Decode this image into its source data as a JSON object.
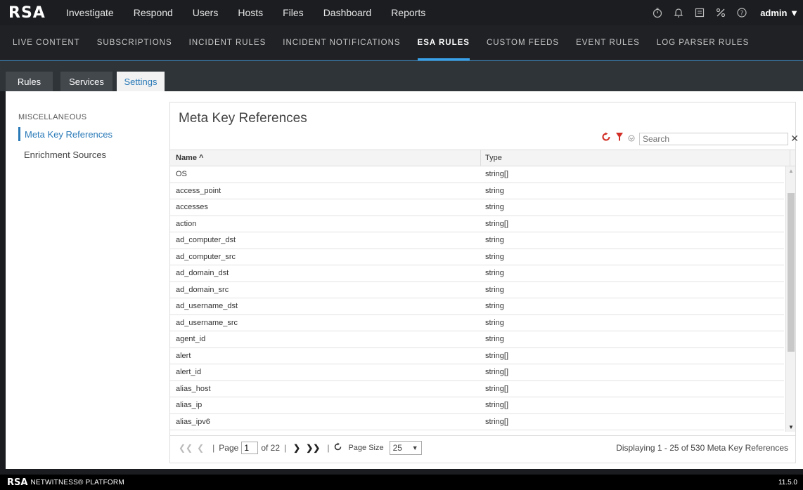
{
  "topnav": {
    "logo": "RSA",
    "items": [
      "Investigate",
      "Respond",
      "Users",
      "Hosts",
      "Files",
      "Dashboard",
      "Reports"
    ],
    "user": "admin"
  },
  "subnav": {
    "items": [
      "LIVE CONTENT",
      "SUBSCRIPTIONS",
      "INCIDENT RULES",
      "INCIDENT NOTIFICATIONS",
      "ESA RULES",
      "CUSTOM FEEDS",
      "EVENT RULES",
      "LOG PARSER RULES"
    ],
    "active": "ESA RULES"
  },
  "tabs": [
    "Rules",
    "Services",
    "Settings"
  ],
  "sidebar": {
    "heading": "MISCELLANEOUS",
    "items": [
      "Meta Key References",
      "Enrichment Sources"
    ]
  },
  "panel": {
    "title": "Meta Key References",
    "search_placeholder": "Search",
    "columns": {
      "name": "Name ^",
      "type": "Type"
    },
    "rows": [
      [
        "OS",
        "string[]"
      ],
      [
        "access_point",
        "string"
      ],
      [
        "accesses",
        "string"
      ],
      [
        "action",
        "string[]"
      ],
      [
        "ad_computer_dst",
        "string"
      ],
      [
        "ad_computer_src",
        "string"
      ],
      [
        "ad_domain_dst",
        "string"
      ],
      [
        "ad_domain_src",
        "string"
      ],
      [
        "ad_username_dst",
        "string"
      ],
      [
        "ad_username_src",
        "string"
      ],
      [
        "agent_id",
        "string"
      ],
      [
        "alert",
        "string[]"
      ],
      [
        "alert_id",
        "string[]"
      ],
      [
        "alias_host",
        "string[]"
      ],
      [
        "alias_ip",
        "string[]"
      ],
      [
        "alias_ipv6",
        "string[]"
      ]
    ],
    "pager": {
      "page_label": "Page",
      "page_value": "1",
      "of_label": "of 22",
      "page_size_label": "Page Size",
      "page_size": "25",
      "status": "Displaying 1 - 25 of 530 Meta Key References"
    }
  },
  "footer": {
    "logo": "RSA",
    "product": "NETWITNESS® PLATFORM",
    "version": "11.5.0"
  },
  "colors": {
    "accent": "#2a7ab8",
    "active_underline": "#3aa0e8",
    "refresh": "#d22f27"
  }
}
